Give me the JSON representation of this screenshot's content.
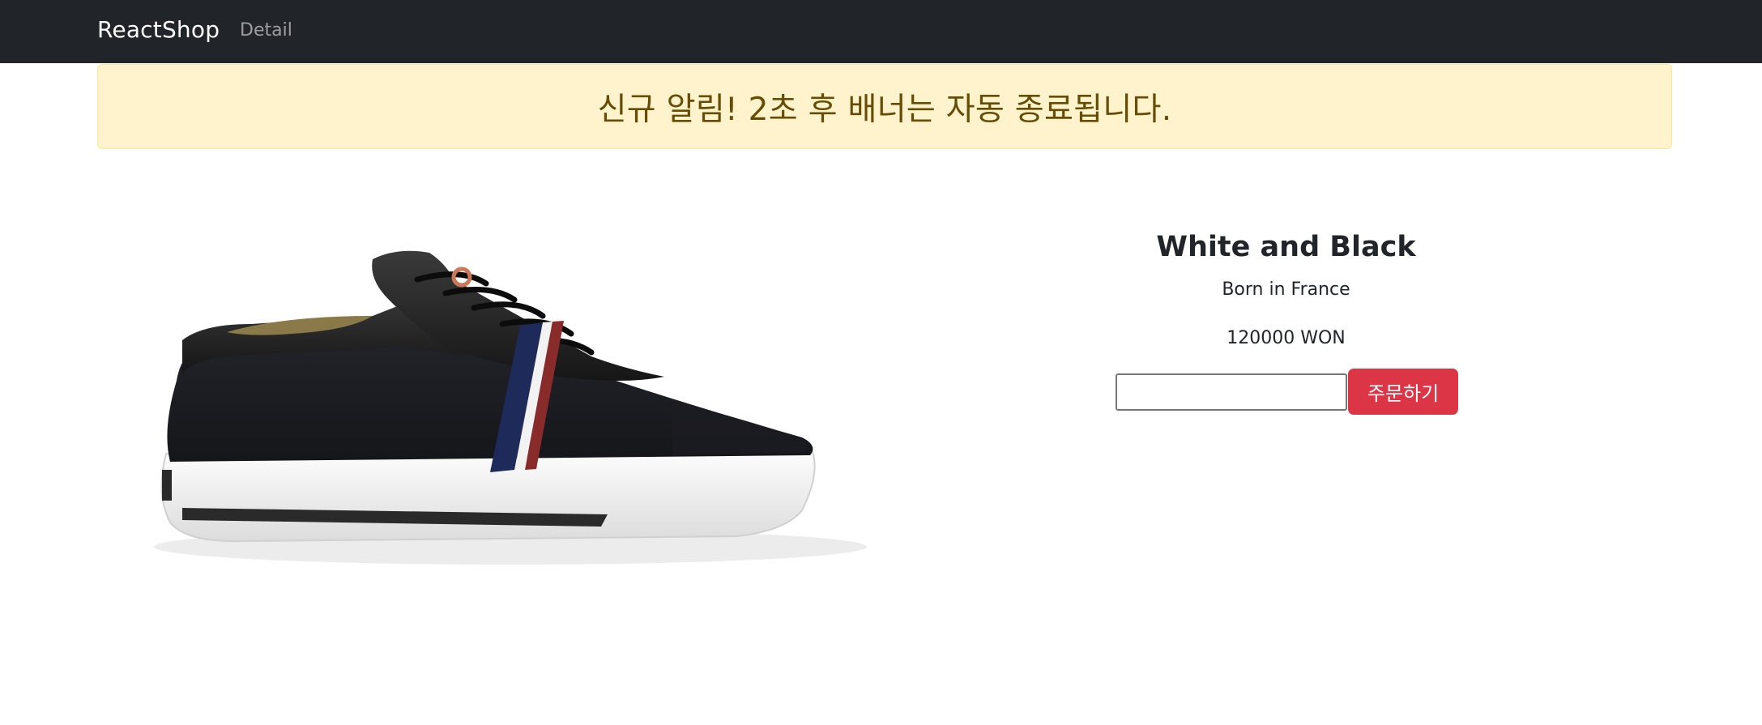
{
  "navbar": {
    "brand": "ReactShop",
    "links": [
      "Detail"
    ]
  },
  "alert": {
    "message": "신규 알림! 2초 후 배너는 자동 종료됩니다."
  },
  "product": {
    "title": "White and Black",
    "origin": "Born in France",
    "price": "120000 WON",
    "image": "black-canvas-sneaker"
  },
  "order": {
    "quantity_value": "",
    "button_label": "주문하기"
  },
  "colors": {
    "navbar_bg": "#212529",
    "alert_bg": "#fff3cd",
    "alert_text": "#664d03",
    "button_bg": "#dc3545"
  }
}
